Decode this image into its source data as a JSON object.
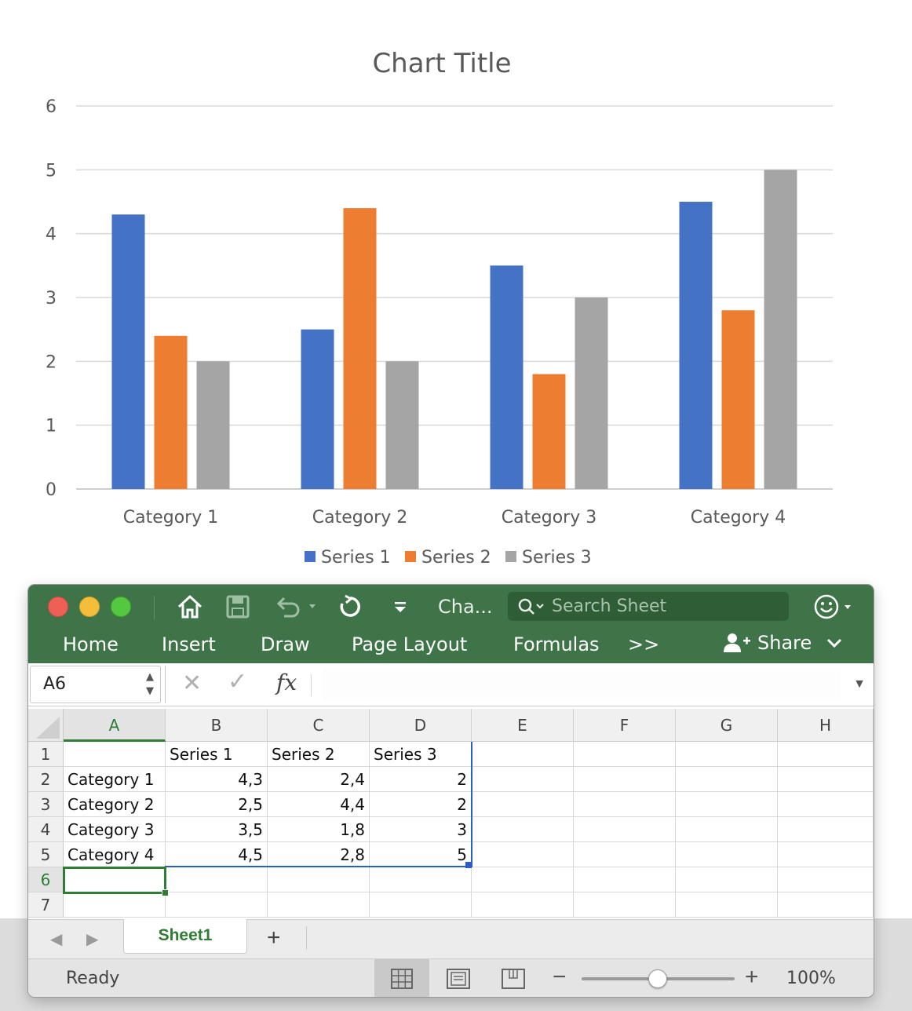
{
  "chart_data": {
    "type": "bar",
    "title": "Chart Title",
    "categories": [
      "Category 1",
      "Category 2",
      "Category 3",
      "Category 4"
    ],
    "series": [
      {
        "name": "Series 1",
        "values": [
          4.3,
          2.5,
          3.5,
          4.5
        ],
        "color": "#4472c4"
      },
      {
        "name": "Series 2",
        "values": [
          2.4,
          4.4,
          1.8,
          2.8
        ],
        "color": "#ed7d31"
      },
      {
        "name": "Series 3",
        "values": [
          2,
          2,
          3,
          5
        ],
        "color": "#a5a5a5"
      }
    ],
    "ylim": [
      0,
      6
    ],
    "yticks": [
      "0",
      "1",
      "2",
      "3",
      "4",
      "5",
      "6"
    ],
    "grid": true,
    "legend": "bottom"
  },
  "window": {
    "title": "Cha...",
    "search_placeholder": "Search Sheet",
    "tabs": [
      "Home",
      "Insert",
      "Draw",
      "Page Layout",
      "Formulas"
    ],
    "more_tabs": ">>",
    "share_label": "Share",
    "accent": "#3e7447"
  },
  "formula_bar": {
    "name_box": "A6",
    "fx": "fx",
    "value": ""
  },
  "sheet": {
    "columns": [
      "A",
      "B",
      "C",
      "D",
      "E",
      "F",
      "G",
      "H"
    ],
    "rows": [
      "1",
      "2",
      "3",
      "4",
      "5",
      "6",
      "7"
    ],
    "cells": [
      [
        "",
        "Series 1",
        "Series 2",
        "Series 3"
      ],
      [
        "Category 1",
        "4,3",
        "2,4",
        "2"
      ],
      [
        "Category 2",
        "2,5",
        "4,4",
        "2"
      ],
      [
        "Category 3",
        "3,5",
        "1,8",
        "3"
      ],
      [
        "Category 4",
        "4,5",
        "2,8",
        "5"
      ],
      [
        "",
        "",
        "",
        ""
      ],
      [
        "",
        "",
        "",
        ""
      ]
    ],
    "active_cell": "A6",
    "tab_name": "Sheet1",
    "add_sheet": "+"
  },
  "status": {
    "text": "Ready",
    "zoom": "100%",
    "zoom_value": 100
  }
}
